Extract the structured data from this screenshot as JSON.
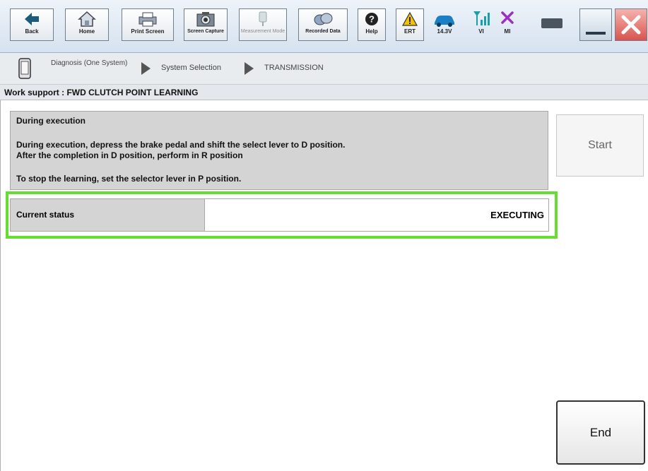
{
  "toolbar": {
    "buttons": [
      {
        "label": "Back",
        "icon": "back-arrow-icon"
      },
      {
        "label": "Home",
        "icon": "home-icon"
      },
      {
        "label": "Print Screen",
        "icon": "printer-icon"
      },
      {
        "label": "Screen Capture",
        "icon": "camera-icon"
      },
      {
        "label": "Measurement Mode",
        "icon": "measurement-icon",
        "disabled": true
      },
      {
        "label": "Recorded Data",
        "icon": "recorded-data-icon"
      },
      {
        "label": "Help",
        "icon": "help-icon"
      },
      {
        "label": "ERT",
        "icon": "warning-icon"
      }
    ],
    "status": {
      "voltage": "14.3V",
      "vi": "VI",
      "mi": "MI"
    }
  },
  "breadcrumb": {
    "item1": "Diagnosis (One System)",
    "item2": "System Selection",
    "item3": "TRANSMISSION"
  },
  "page_title": "Work support : FWD CLUTCH POINT LEARNING",
  "info": {
    "heading": "During execution",
    "line1": "During execution, depress the brake pedal and shift the select lever to D position.",
    "line2": "After the completion in D position, perform in R position",
    "line3": "To stop the learning, set the selector lever in P position."
  },
  "start_label": "Start",
  "status_row": {
    "label": "Current status",
    "value": "EXECUTING"
  },
  "end_label": "End",
  "colors": {
    "highlight": "#66dd33",
    "panel": "#d4d4d4",
    "warning": "#f2c200",
    "close": "#d9534f"
  }
}
